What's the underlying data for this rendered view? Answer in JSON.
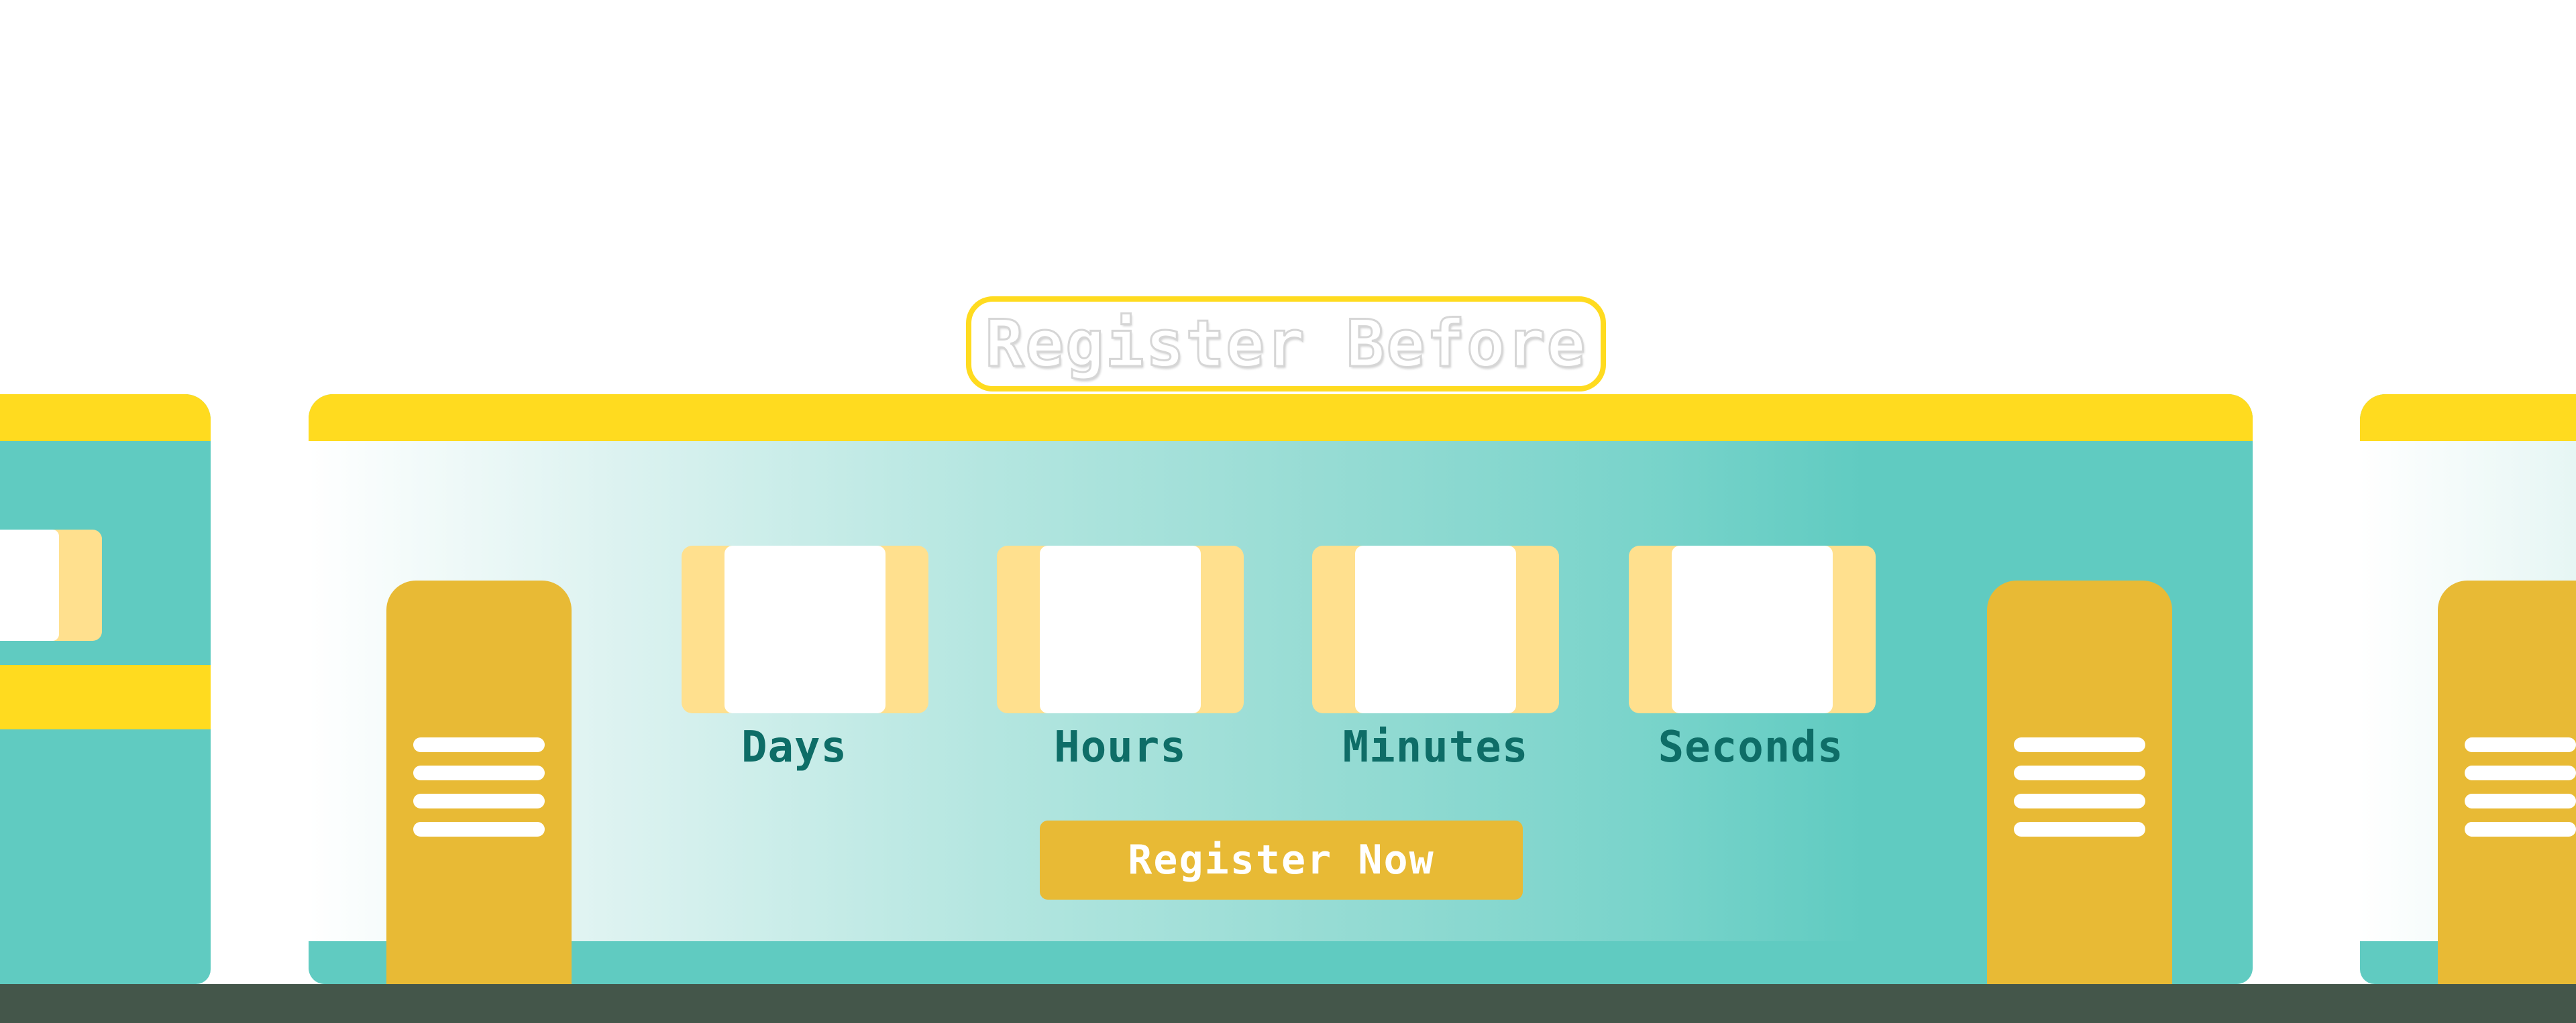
{
  "sign": {
    "title": "Register Before"
  },
  "countdown": {
    "units": [
      {
        "label": "Days",
        "value": ""
      },
      {
        "label": "Hours",
        "value": ""
      },
      {
        "label": "Minutes",
        "value": ""
      },
      {
        "label": "Seconds",
        "value": ""
      }
    ]
  },
  "cta": {
    "label": "Register Now"
  },
  "colors": {
    "roof_yellow": "#ffdb1f",
    "train_teal": "#60cbc1",
    "door_gold": "#e8ba35",
    "counter_tan": "#ffe08e",
    "label_teal": "#0e6d67",
    "ground": "#44564a"
  }
}
